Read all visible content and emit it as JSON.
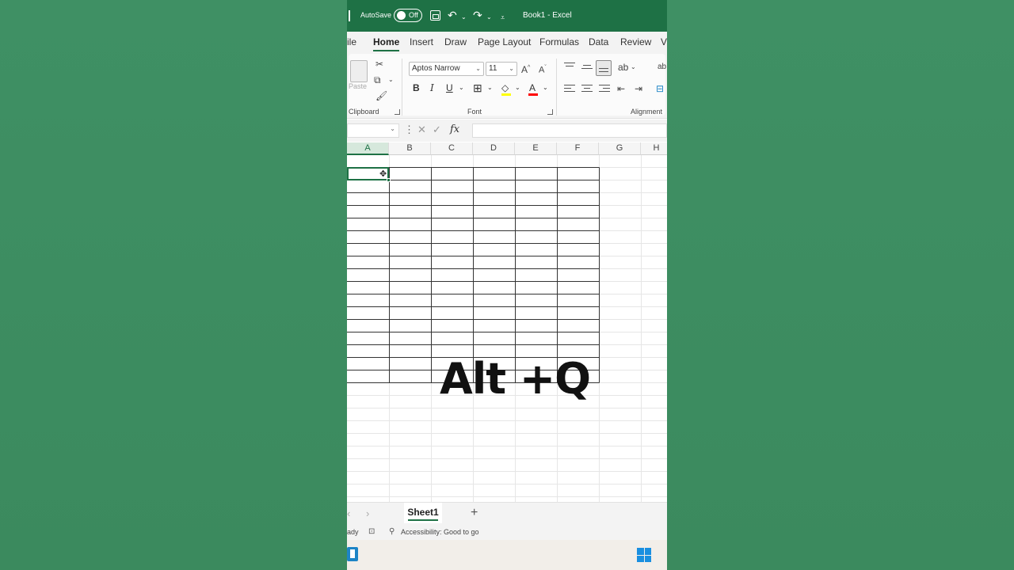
{
  "titlebar": {
    "autosave_label": "AutoSave",
    "autosave_state": "Off",
    "document_title": "Book1  -  Excel"
  },
  "tabs": [
    "ile",
    "Home",
    "Insert",
    "Draw",
    "Page Layout",
    "Formulas",
    "Data",
    "Review",
    "V"
  ],
  "ribbon": {
    "paste_label": "Paste",
    "font_name": "Aptos Narrow",
    "font_size": "11",
    "groups": {
      "clipboard": "Clipboard",
      "font": "Font",
      "alignment": "Alignment"
    },
    "bold": "B",
    "italic": "I",
    "underline": "U",
    "fill_color": "#ffff00",
    "font_color": "#ff0000"
  },
  "formula_bar": {
    "name_box_value": "",
    "fx_label": "fx",
    "formula_value": ""
  },
  "columns": [
    "A",
    "B",
    "C",
    "D",
    "E",
    "F",
    "G",
    "H"
  ],
  "selected_column": "A",
  "overlay_text": "Alt +Q",
  "sheets": [
    "Sheet1"
  ],
  "status": {
    "ready": "ady",
    "accessibility": "Accessibility: Good to go"
  },
  "colors": {
    "accent": "#1e7145",
    "background": "#3f8f63"
  }
}
